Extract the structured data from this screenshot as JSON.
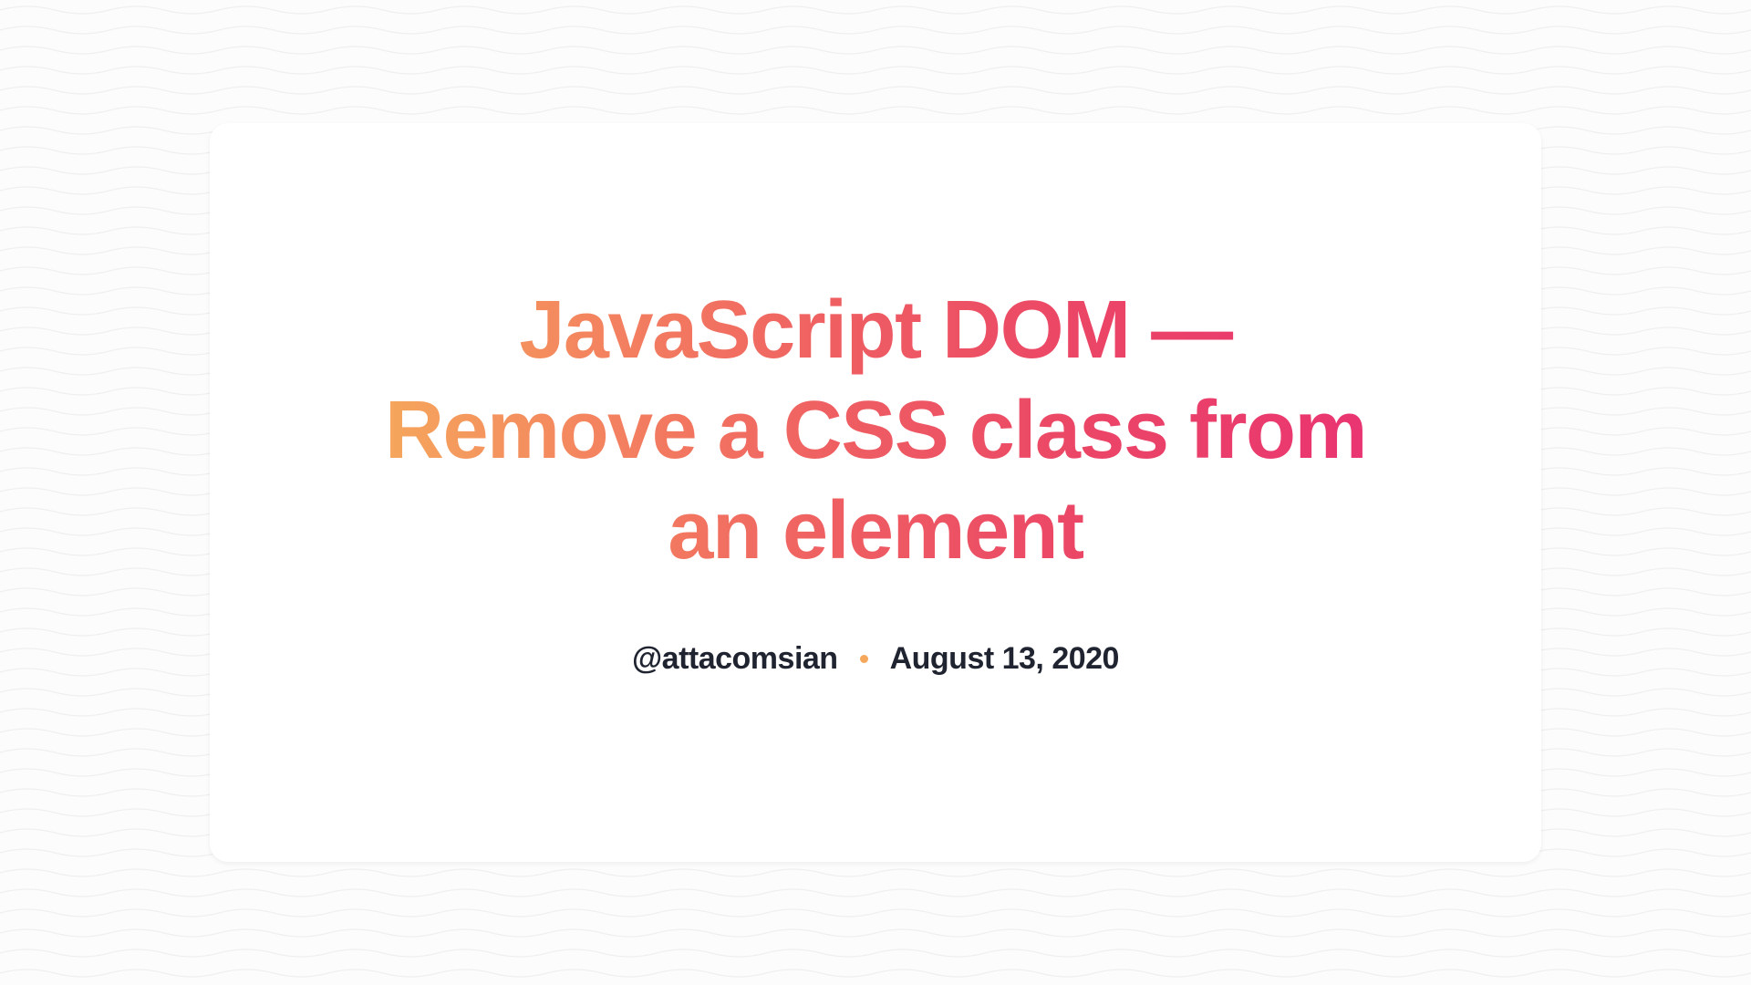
{
  "title": "JavaScript DOM — Remove a CSS class from an element",
  "author": "@attacomsian",
  "date": "August 13, 2020"
}
